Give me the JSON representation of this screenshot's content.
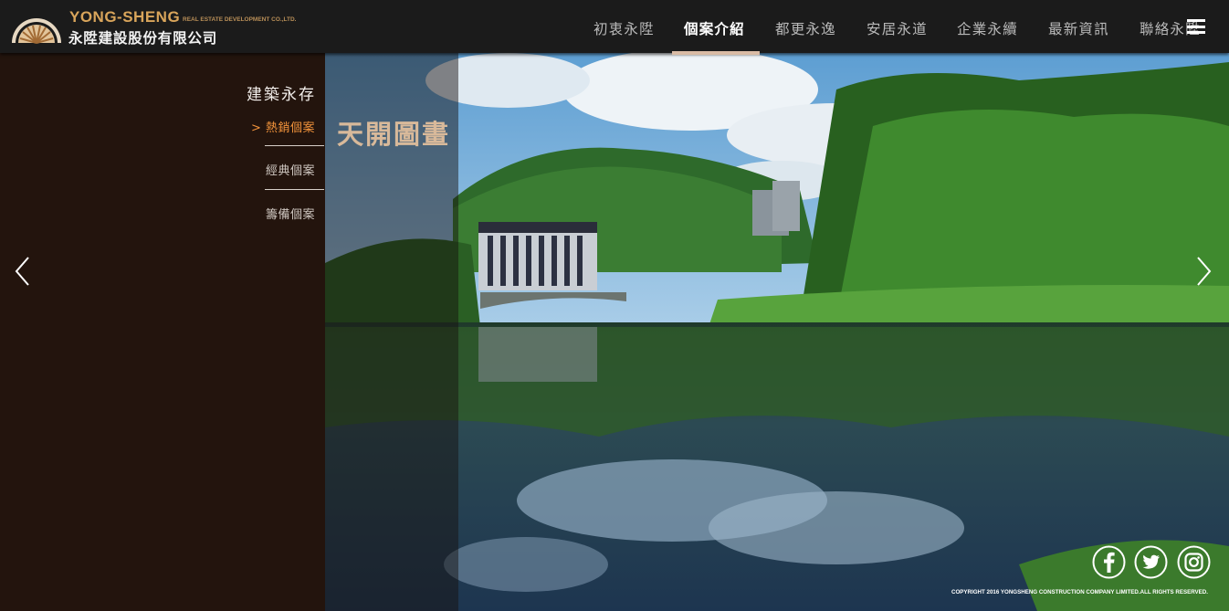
{
  "brand": {
    "name_en": "YONG-SHENG",
    "subtitle_en": "REAL ESTATE DEVELOPMENT CO.,LTD.",
    "name_zh": "永陞建設股份有限公司"
  },
  "nav": {
    "items": [
      {
        "label": "初衷永陞",
        "active": false
      },
      {
        "label": "個案介紹",
        "active": true
      },
      {
        "label": "都更永逸",
        "active": false
      },
      {
        "label": "安居永道",
        "active": false
      },
      {
        "label": "企業永續",
        "active": false
      },
      {
        "label": "最新資訊",
        "active": false
      },
      {
        "label": "聯絡永陞",
        "active": false
      }
    ],
    "menu_icon": "hamburger-icon"
  },
  "sidebar": {
    "title": "建築永存",
    "items": [
      {
        "label": "> 熱銷個案",
        "active": true
      },
      {
        "label": "經典個案",
        "active": false
      },
      {
        "label": "籌備個案",
        "active": false
      }
    ]
  },
  "hero": {
    "project_title": "天開圖畫",
    "prev_icon": "chevron-left-icon",
    "next_icon": "chevron-right-icon"
  },
  "social": [
    "facebook-icon",
    "twitter-icon",
    "instagram-icon"
  ],
  "footer": {
    "copyright": "COPYRIGHT 2016 YONGSHENG CONSTRUCTION COMPANY LIMITED.ALL RIGHTS RESERVED."
  },
  "colors": {
    "header_bg": "#1b1b1b",
    "panel_bg": "#23140d",
    "accent_orange": "#f2933b",
    "gold": "#d9a55b"
  }
}
